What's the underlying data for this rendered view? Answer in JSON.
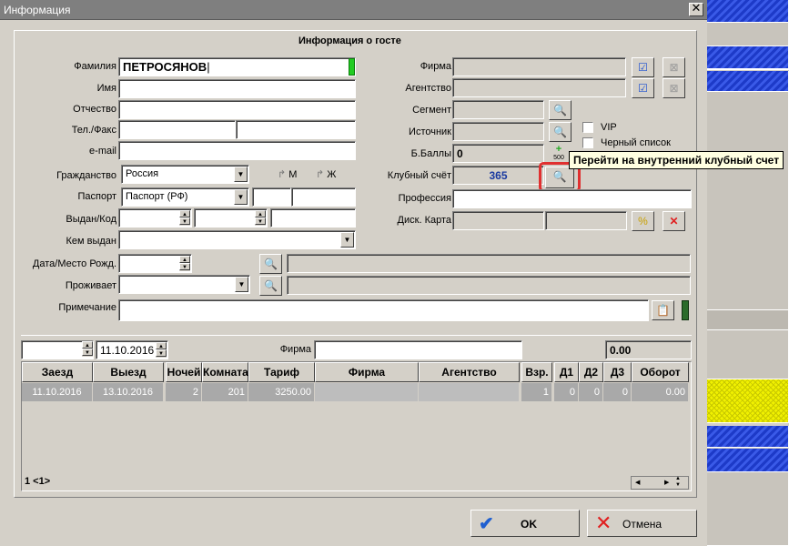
{
  "window": {
    "title": "Информация",
    "close": "✕"
  },
  "form_title": "Информация о госте",
  "guest": {
    "surname_label": "Фамилия",
    "surname": "ПЕТРОСЯНОВ",
    "name_label": "Имя",
    "name": "",
    "patronymic_label": "Отчество",
    "patronymic": "",
    "phone_label": "Тел./Факс",
    "email_label": "e-mail",
    "citizenship_label": "Гражданство",
    "citizenship": "Россия",
    "sex_m": "М",
    "sex_f": "Ж",
    "passport_label": "Паспорт",
    "passport_type": "Паспорт (РФ)",
    "issued_label": "Выдан/Код",
    "issued_by_label": "Кем выдан",
    "birth_label": "Дата/Место Рожд.",
    "residence_label": "Проживает",
    "note_label": "Примечание"
  },
  "right": {
    "firm_label": "Фирма",
    "agency_label": "Агентство",
    "segment_label": "Сегмент",
    "source_label": "Источник",
    "points_label": "Б.Баллы",
    "points": "0",
    "club_label": "Клубный счёт",
    "club": "365",
    "profession_label": "Профессия",
    "disc_label": "Диск. Карта",
    "vip": "VIP",
    "blacklist": "Черный список",
    "plus500": "500"
  },
  "tooltip": "Перейти на внутренний клубный счет",
  "stays": {
    "date_from": "",
    "date_to": "11.10.2016",
    "firm_label": "Фирма",
    "total": "0.00",
    "headers": [
      "Заезд",
      "Выезд",
      "Ночей",
      "Комната",
      "Тариф",
      "Фирма",
      "Агентство",
      "Взр.",
      "Д1",
      "Д2",
      "Д3",
      "Оборот"
    ],
    "row": [
      "11.10.2016",
      "13.10.2016",
      "2",
      "201",
      "3250.00",
      "",
      "",
      "1",
      "0",
      "0",
      "0",
      "0.00"
    ],
    "pager": "1 <1>"
  },
  "buttons": {
    "ok": "OK",
    "cancel": "Отмена"
  },
  "colors": {
    "title_bar": "#7f7f7f",
    "tooltip_bg": "#ffffe1",
    "highlight": "#e03030",
    "ok_check": "#1f5fd0",
    "cancel_x": "#e02020"
  }
}
